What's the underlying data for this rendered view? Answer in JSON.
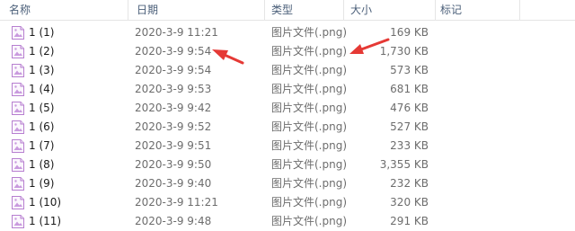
{
  "columns": {
    "name": "名称",
    "date": "日期",
    "type": "类型",
    "size": "大小",
    "tags": "标记"
  },
  "files": [
    {
      "name": "1 (1)",
      "date": "2020-3-9 11:21",
      "type": "图片文件(.png)",
      "size": "169 KB"
    },
    {
      "name": "1 (2)",
      "date": "2020-3-9 9:54",
      "type": "图片文件(.png)",
      "size": "1,730 KB"
    },
    {
      "name": "1 (3)",
      "date": "2020-3-9 9:54",
      "type": "图片文件(.png)",
      "size": "573 KB"
    },
    {
      "name": "1 (4)",
      "date": "2020-3-9 9:53",
      "type": "图片文件(.png)",
      "size": "681 KB"
    },
    {
      "name": "1 (5)",
      "date": "2020-3-9 9:42",
      "type": "图片文件(.png)",
      "size": "476 KB"
    },
    {
      "name": "1 (6)",
      "date": "2020-3-9 9:52",
      "type": "图片文件(.png)",
      "size": "527 KB"
    },
    {
      "name": "1 (7)",
      "date": "2020-3-9 9:51",
      "type": "图片文件(.png)",
      "size": "233 KB"
    },
    {
      "name": "1 (8)",
      "date": "2020-3-9 9:50",
      "type": "图片文件(.png)",
      "size": "3,355 KB"
    },
    {
      "name": "1 (9)",
      "date": "2020-3-9 9:40",
      "type": "图片文件(.png)",
      "size": "232 KB"
    },
    {
      "name": "1 (10)",
      "date": "2020-3-9 11:21",
      "type": "图片文件(.png)",
      "size": "320 KB"
    },
    {
      "name": "1 (11)",
      "date": "2020-3-9 9:48",
      "type": "图片文件(.png)",
      "size": "291 KB"
    }
  ],
  "icons": {
    "file": "image-file-icon",
    "sort": "sort-caret-icon",
    "annotation": "red-arrow-icon"
  },
  "colors": {
    "header_text": "#4c607a",
    "row_text": "#6d6d6d",
    "arrow": "#e53935",
    "icon_accent": "#b77fd0"
  }
}
